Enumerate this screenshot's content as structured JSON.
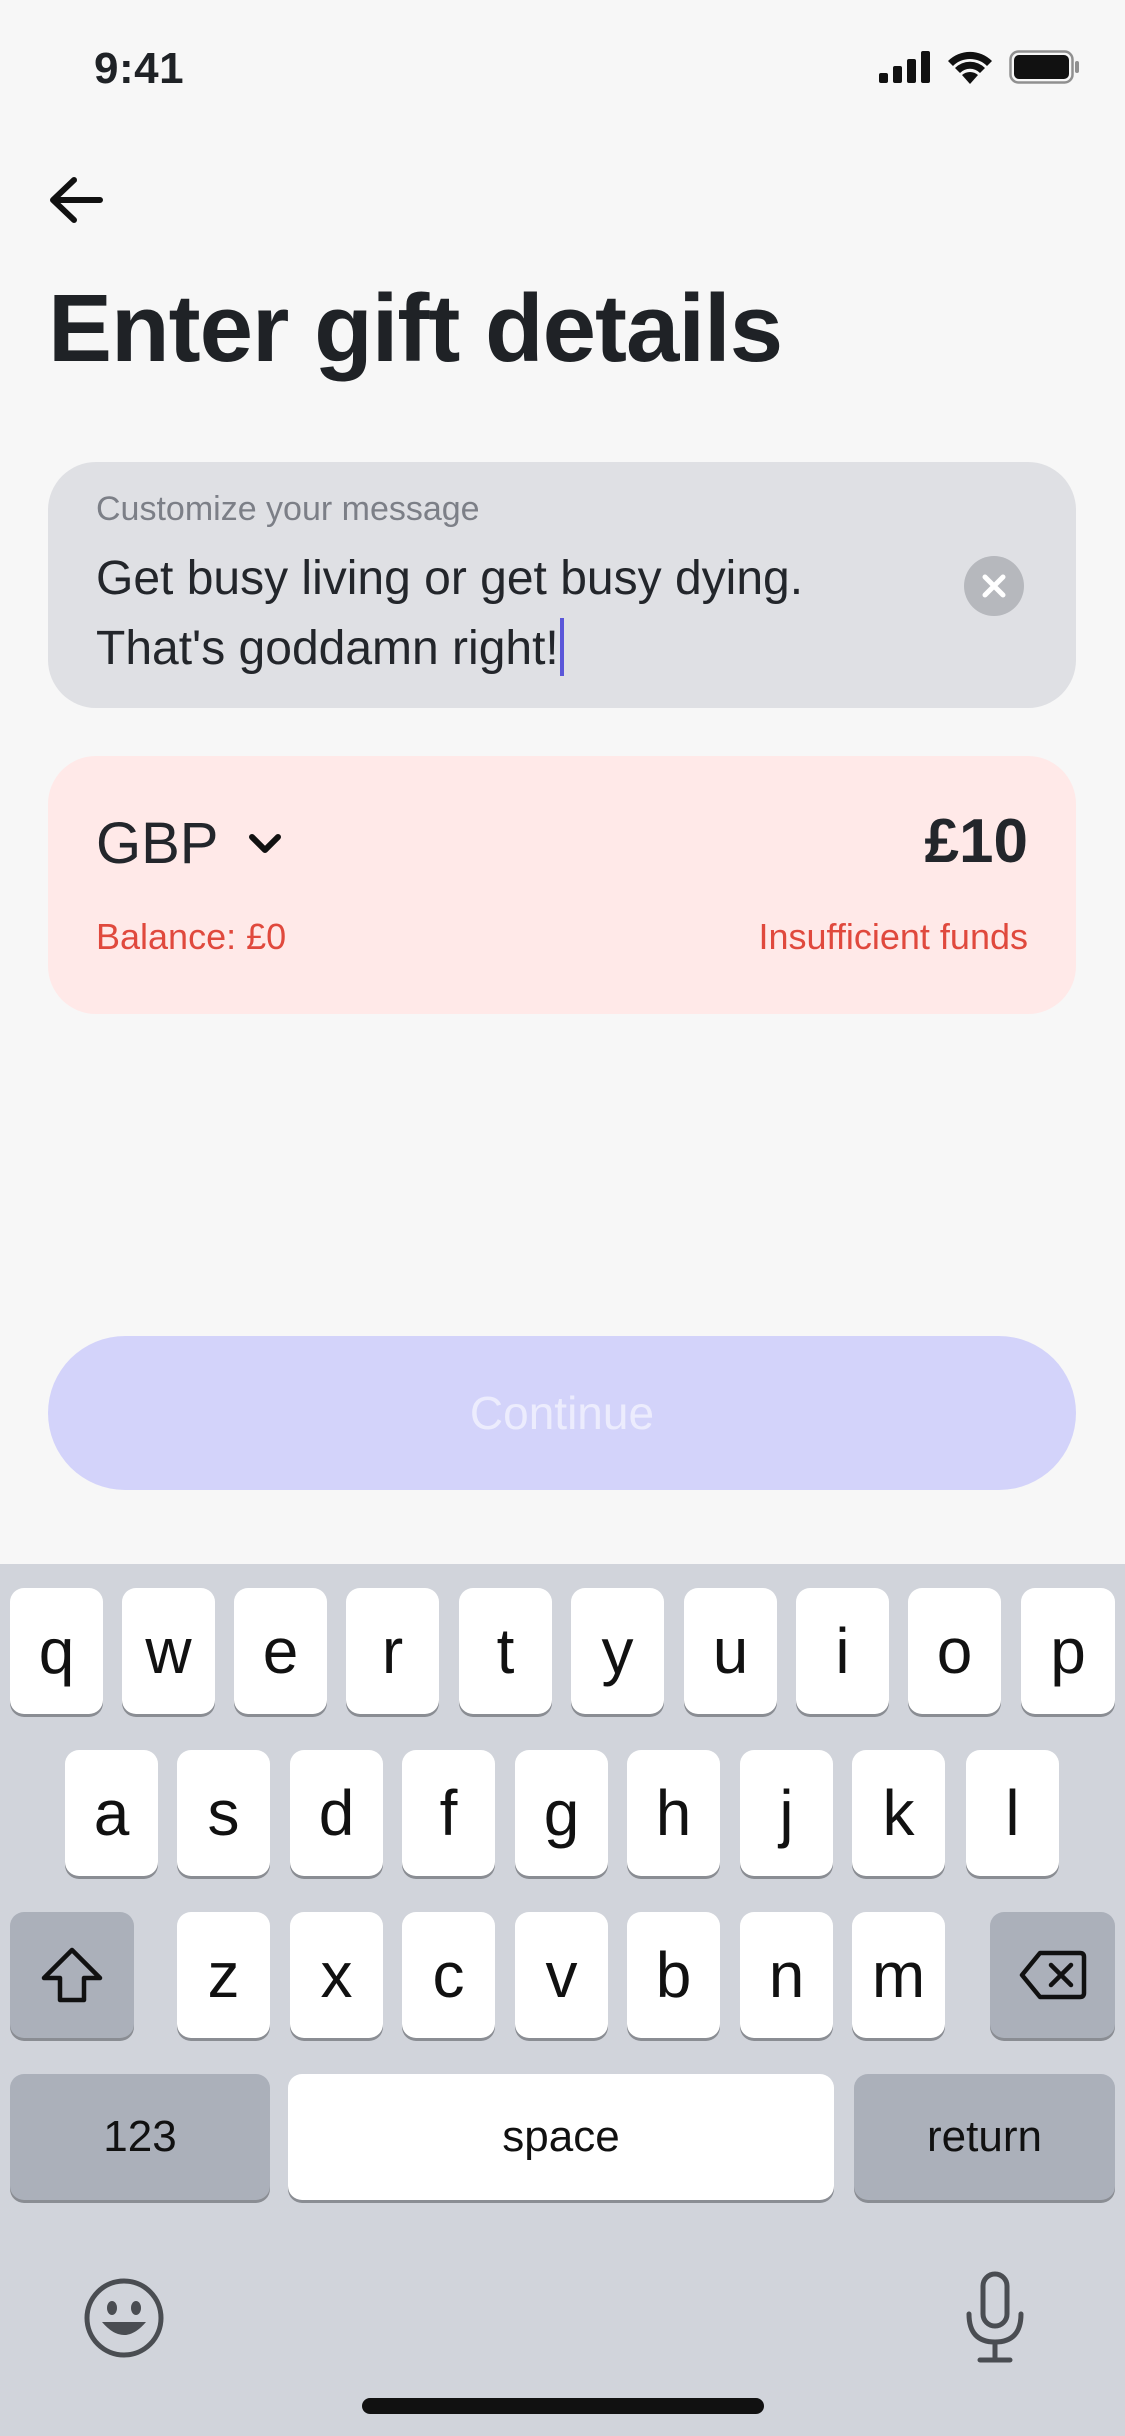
{
  "status_bar": {
    "time": "9:41"
  },
  "page": {
    "title": "Enter gift details"
  },
  "message": {
    "label": "Customize your message",
    "line1": "Get busy living or get busy dying.",
    "line2": "That's goddamn right!"
  },
  "amount": {
    "currency": "GBP",
    "value": "£10",
    "balance": "Balance: £0",
    "error": "Insufficient funds"
  },
  "actions": {
    "continue_label": "Continue"
  },
  "keyboard": {
    "row1": [
      "q",
      "w",
      "e",
      "r",
      "t",
      "y",
      "u",
      "i",
      "o",
      "p"
    ],
    "row2": [
      "a",
      "s",
      "d",
      "f",
      "g",
      "h",
      "j",
      "k",
      "l"
    ],
    "row3": [
      "z",
      "x",
      "c",
      "v",
      "b",
      "n",
      "m"
    ],
    "numbers_label": "123",
    "space_label": "space",
    "return_label": "return"
  },
  "colors": {
    "accent_disabled": "#d3d3fa",
    "error": "#e0493d",
    "error_bg": "#ffe9e8",
    "caret": "#5b57d9"
  },
  "icons": {
    "back": "arrow-left-icon",
    "clear": "close-circle-icon",
    "currency_dropdown": "chevron-down-icon",
    "shift": "shift-icon",
    "delete": "backspace-icon",
    "emoji": "emoji-icon",
    "mic": "microphone-icon"
  }
}
